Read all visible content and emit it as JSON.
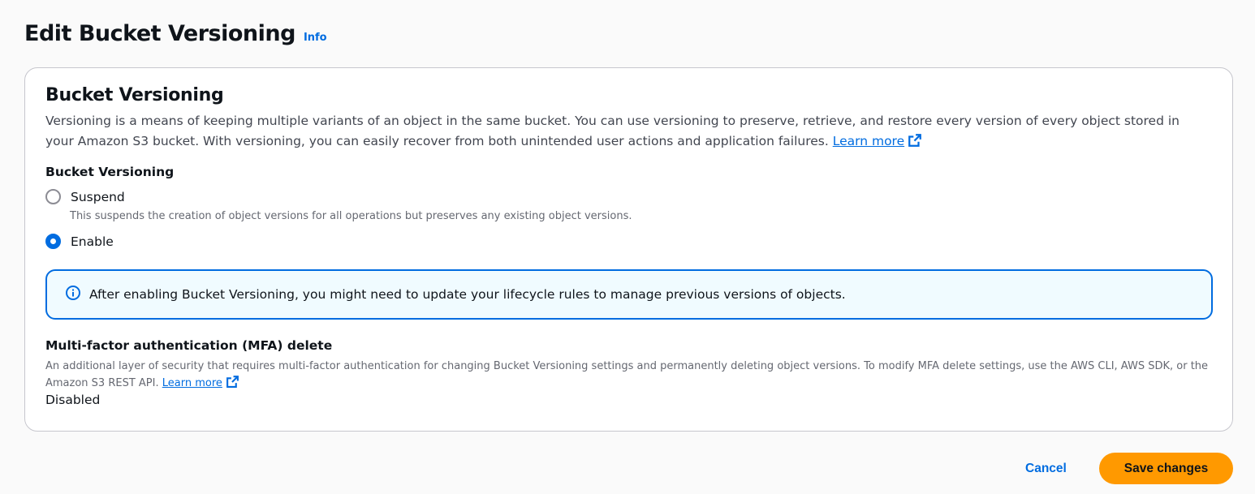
{
  "header": {
    "title": "Edit Bucket Versioning",
    "info_link": "Info"
  },
  "versioning_section": {
    "title": "Bucket Versioning",
    "description": "Versioning is a means of keeping multiple variants of an object in the same bucket. You can use versioning to preserve, retrieve, and restore every version of every object stored in your Amazon S3 bucket. With versioning, you can easily recover from both unintended user actions and application failures.",
    "learn_more": "Learn more",
    "field_label": "Bucket Versioning",
    "options": [
      {
        "label": "Suspend",
        "description": "This suspends the creation of object versions for all operations but preserves any existing object versions.",
        "selected": false
      },
      {
        "label": "Enable",
        "description": "",
        "selected": true
      }
    ],
    "alert_text": "After enabling Bucket Versioning, you might need to update your lifecycle rules to manage previous versions of objects."
  },
  "mfa": {
    "title": "Multi-factor authentication (MFA) delete",
    "description": "An additional layer of security that requires multi-factor authentication for changing Bucket Versioning settings and permanently deleting object versions. To modify MFA delete settings, use the AWS CLI, AWS SDK, or the Amazon S3 REST API.",
    "learn_more": "Learn more",
    "value": "Disabled"
  },
  "footer": {
    "cancel_label": "Cancel",
    "save_label": "Save changes"
  },
  "icons": {
    "external_link": "external-link-icon",
    "info": "info-circle-icon"
  },
  "colors": {
    "link": "#006ce0",
    "primary_button": "#ff9900",
    "alert_background": "#f0fbff",
    "alert_border": "#006ce0"
  }
}
